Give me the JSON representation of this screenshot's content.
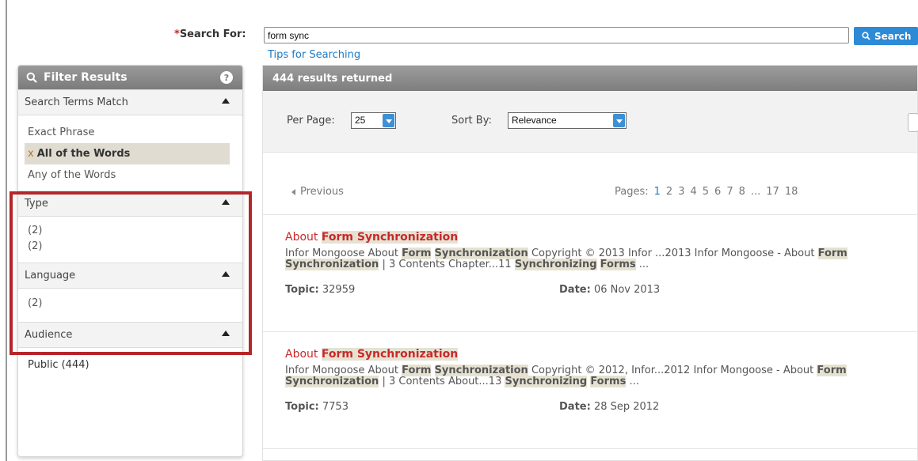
{
  "search": {
    "required_mark": "*",
    "label": "Search For:",
    "value": "form sync",
    "button_label": "Search",
    "tips_link": "Tips for Searching"
  },
  "filter": {
    "title": "Filter Results",
    "help_glyph": "?",
    "sections": {
      "terms": {
        "label": "Search Terms Match",
        "options": [
          "Exact Phrase",
          "All of the Words",
          "Any of the Words"
        ],
        "selected_marker": "x"
      },
      "type": {
        "label": "Type",
        "options": [
          "(2)",
          "(2)"
        ]
      },
      "language": {
        "label": "Language",
        "options": [
          "(2)"
        ]
      },
      "audience": {
        "label": "Audience",
        "options": [
          "Public (444)"
        ]
      }
    }
  },
  "results": {
    "count_text": "444 results returned",
    "per_page_label": "Per Page:",
    "per_page_value": "25",
    "sort_label": "Sort By:",
    "sort_value": "Relevance",
    "pager": {
      "previous": "Previous",
      "pages_label": "Pages:",
      "pages": [
        "1",
        "2",
        "3",
        "4",
        "5",
        "6",
        "7",
        "8",
        "...",
        "17",
        "18"
      ],
      "current": "1"
    },
    "items": [
      {
        "title_prefix": "About ",
        "title_hl": "Form Synchronization",
        "s1": "Infor Mongoose About ",
        "s2": "Form",
        "s3": "Synchronization",
        "s4": " Copyright © 2013 Infor ...2013 Infor Mongoose - About ",
        "s5": "Form",
        "s6": "Synchronization",
        "s7": " | 3 Contents Chapter...11 ",
        "s8": "Synchronizing",
        "s9": "Forms",
        "s10": " ...",
        "topic_label": "Topic:",
        "topic": "32959",
        "date_label": "Date:",
        "date": "06 Nov 2013"
      },
      {
        "title_prefix": "About ",
        "title_hl": "Form Synchronization",
        "s1": "Infor Mongoose About ",
        "s2": "Form",
        "s3": "Synchronization",
        "s4": " Copyright © 2012, Infor...2012 Infor Mongoose - About ",
        "s5": "Form",
        "s6": "Synchronization",
        "s7": " | 3 Contents About...13 ",
        "s8": "Synchronizing",
        "s9": "Forms",
        "s10": " ...",
        "topic_label": "Topic:",
        "topic": "7753",
        "date_label": "Date:",
        "date": "28 Sep 2012"
      }
    ]
  },
  "colors": {
    "accent_blue": "#2d8ad6",
    "highlight_red": "#c8282a",
    "annotation_box": "#b5262a"
  },
  "icons": {
    "search": "magnifier-icon",
    "help": "help-icon",
    "collapse": "triangle-up-icon",
    "dropdown": "chevron-down-icon",
    "previous": "triangle-left-icon"
  }
}
